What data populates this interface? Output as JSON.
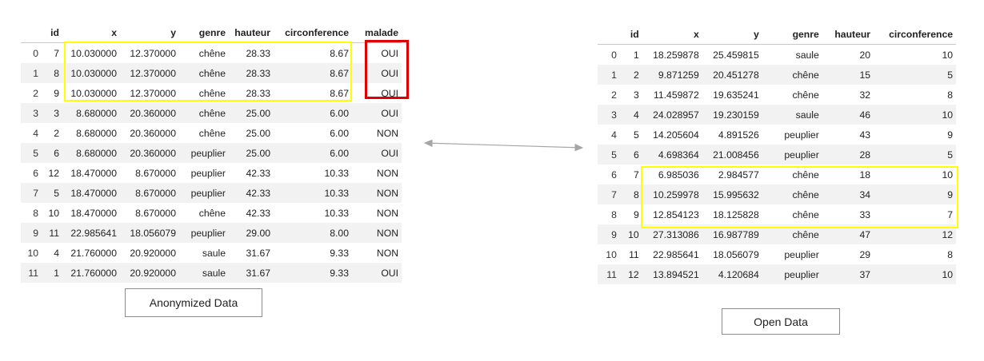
{
  "left_table": {
    "columns": [
      "",
      "id",
      "x",
      "y",
      "genre",
      "hauteur",
      "circonference",
      "malade"
    ],
    "rows": [
      [
        "0",
        "7",
        "10.030000",
        "12.370000",
        "chêne",
        "28.33",
        "8.67",
        "OUI"
      ],
      [
        "1",
        "8",
        "10.030000",
        "12.370000",
        "chêne",
        "28.33",
        "8.67",
        "OUI"
      ],
      [
        "2",
        "9",
        "10.030000",
        "12.370000",
        "chêne",
        "28.33",
        "8.67",
        "OUI"
      ],
      [
        "3",
        "3",
        "8.680000",
        "20.360000",
        "chêne",
        "25.00",
        "6.00",
        "OUI"
      ],
      [
        "4",
        "2",
        "8.680000",
        "20.360000",
        "chêne",
        "25.00",
        "6.00",
        "NON"
      ],
      [
        "5",
        "6",
        "8.680000",
        "20.360000",
        "peuplier",
        "25.00",
        "6.00",
        "OUI"
      ],
      [
        "6",
        "12",
        "18.470000",
        "8.670000",
        "peuplier",
        "42.33",
        "10.33",
        "NON"
      ],
      [
        "7",
        "5",
        "18.470000",
        "8.670000",
        "peuplier",
        "42.33",
        "10.33",
        "NON"
      ],
      [
        "8",
        "10",
        "18.470000",
        "8.670000",
        "chêne",
        "42.33",
        "10.33",
        "NON"
      ],
      [
        "9",
        "11",
        "22.985641",
        "18.056079",
        "peuplier",
        "29.00",
        "8.00",
        "NON"
      ],
      [
        "10",
        "4",
        "21.760000",
        "20.920000",
        "saule",
        "31.67",
        "9.33",
        "NON"
      ],
      [
        "11",
        "1",
        "21.760000",
        "20.920000",
        "saule",
        "31.67",
        "9.33",
        "OUI"
      ]
    ],
    "caption": "Anonymized Data"
  },
  "right_table": {
    "columns": [
      "",
      "id",
      "x",
      "y",
      "genre",
      "hauteur",
      "circonference"
    ],
    "rows": [
      [
        "0",
        "1",
        "18.259878",
        "25.459815",
        "saule",
        "20",
        "10"
      ],
      [
        "1",
        "2",
        "9.871259",
        "20.451278",
        "chêne",
        "15",
        "5"
      ],
      [
        "2",
        "3",
        "11.459872",
        "19.635241",
        "chêne",
        "32",
        "8"
      ],
      [
        "3",
        "4",
        "24.028957",
        "19.230159",
        "saule",
        "46",
        "10"
      ],
      [
        "4",
        "5",
        "14.205604",
        "4.891526",
        "peuplier",
        "43",
        "9"
      ],
      [
        "5",
        "6",
        "4.698364",
        "21.008456",
        "peuplier",
        "28",
        "5"
      ],
      [
        "6",
        "7",
        "6.985036",
        "2.984577",
        "chêne",
        "18",
        "10"
      ],
      [
        "7",
        "8",
        "10.259978",
        "15.995632",
        "chêne",
        "34",
        "9"
      ],
      [
        "8",
        "9",
        "12.854123",
        "18.125828",
        "chêne",
        "33",
        "7"
      ],
      [
        "9",
        "10",
        "27.313086",
        "16.987789",
        "chêne",
        "47",
        "12"
      ],
      [
        "10",
        "11",
        "22.985641",
        "18.056079",
        "peuplier",
        "29",
        "8"
      ],
      [
        "11",
        "12",
        "13.894521",
        "4.120684",
        "peuplier",
        "37",
        "10"
      ]
    ],
    "caption": "Open Data"
  },
  "colors": {
    "highlight_yellow": "#ffff00",
    "highlight_red": "#e00000",
    "arrow": "#a6a6a6",
    "row_stripe": "#f2f2f2"
  }
}
